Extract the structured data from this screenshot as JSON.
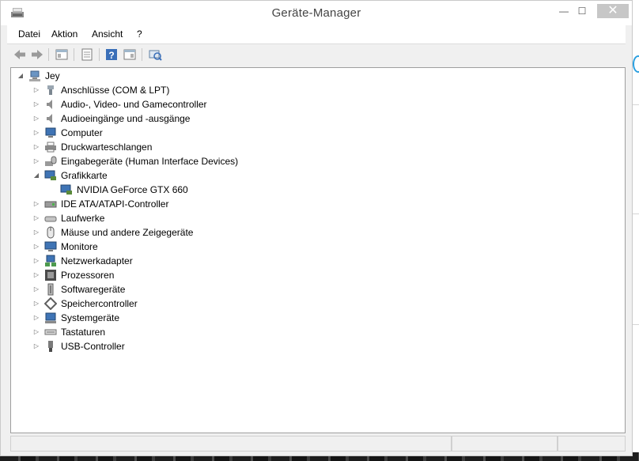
{
  "window": {
    "title": "Geräte-Manager",
    "controls": {
      "minimize": "—",
      "maximize": "☐",
      "close": "✕"
    }
  },
  "menu": [
    "Datei",
    "Aktion",
    "Ansicht",
    "?"
  ],
  "toolbar": [
    {
      "icon": "back-arrow-icon"
    },
    {
      "icon": "forward-arrow-icon"
    },
    {
      "icon": "show-hide-console-tree-icon"
    },
    {
      "icon": "properties-icon"
    },
    {
      "icon": "help-icon"
    },
    {
      "icon": "action-pane-icon"
    },
    {
      "icon": "scan-hardware-changes-icon"
    }
  ],
  "tree": {
    "root": {
      "label": "Jey",
      "expanded": true,
      "icon": "computer-network-icon"
    },
    "categories": [
      {
        "label": "Anschlüsse (COM & LPT)",
        "icon": "port-icon",
        "expanded": false
      },
      {
        "label": "Audio-, Video- und Gamecontroller",
        "icon": "speaker-icon",
        "expanded": false
      },
      {
        "label": "Audioeingänge und -ausgänge",
        "icon": "speaker-icon",
        "expanded": false
      },
      {
        "label": "Computer",
        "icon": "computer-icon",
        "expanded": false
      },
      {
        "label": "Druckwarteschlangen",
        "icon": "printer-icon",
        "expanded": false
      },
      {
        "label": "Eingabegeräte (Human Interface Devices)",
        "icon": "hid-icon",
        "expanded": false
      },
      {
        "label": "Grafikkarte",
        "icon": "display-adapter-icon",
        "expanded": true,
        "children": [
          {
            "label": "NVIDIA GeForce GTX 660",
            "icon": "display-adapter-icon"
          }
        ]
      },
      {
        "label": "IDE ATA/ATAPI-Controller",
        "icon": "ide-controller-icon",
        "expanded": false
      },
      {
        "label": "Laufwerke",
        "icon": "drive-icon",
        "expanded": false
      },
      {
        "label": "Mäuse und andere Zeigegeräte",
        "icon": "mouse-icon",
        "expanded": false
      },
      {
        "label": "Monitore",
        "icon": "monitor-icon",
        "expanded": false
      },
      {
        "label": "Netzwerkadapter",
        "icon": "network-adapter-icon",
        "expanded": false
      },
      {
        "label": "Prozessoren",
        "icon": "processor-icon",
        "expanded": false
      },
      {
        "label": "Softwaregeräte",
        "icon": "software-device-icon",
        "expanded": false
      },
      {
        "label": "Speichercontroller",
        "icon": "storage-controller-icon",
        "expanded": false
      },
      {
        "label": "Systemgeräte",
        "icon": "system-device-icon",
        "expanded": false
      },
      {
        "label": "Tastaturen",
        "icon": "keyboard-icon",
        "expanded": false
      },
      {
        "label": "USB-Controller",
        "icon": "usb-icon",
        "expanded": false
      }
    ]
  },
  "colors": {
    "titlebar": "#ffffff",
    "chrome": "#f0f0f0",
    "close_button": "#c7c7c7",
    "accent_blue": "#2a9fe0"
  }
}
